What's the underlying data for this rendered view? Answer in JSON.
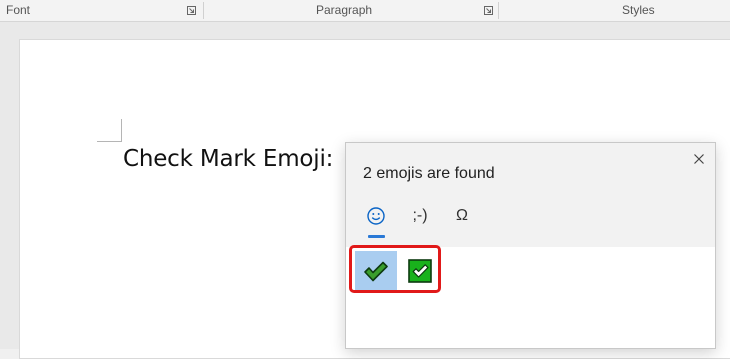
{
  "ribbon": {
    "groups": [
      {
        "label": "Font"
      },
      {
        "label": "Paragraph"
      },
      {
        "label": "Styles"
      }
    ]
  },
  "document": {
    "text": "Check Mark Emoji:"
  },
  "emoji_panel": {
    "result_text": "2 emojis are found",
    "tabs": [
      {
        "name": "emoji",
        "icon": "smiley-icon",
        "active": true
      },
      {
        "name": "kaomoji",
        "label": ";-)",
        "active": false
      },
      {
        "name": "symbols",
        "label": "Ω",
        "active": false
      }
    ],
    "results": [
      {
        "name": "heavy-check-mark",
        "icon": "check-mark-icon",
        "selected": true
      },
      {
        "name": "white-heavy-check-mark",
        "icon": "green-check-box-icon",
        "selected": false
      }
    ],
    "accent_color": "#2a79d6",
    "highlight_color": "#e11919"
  }
}
